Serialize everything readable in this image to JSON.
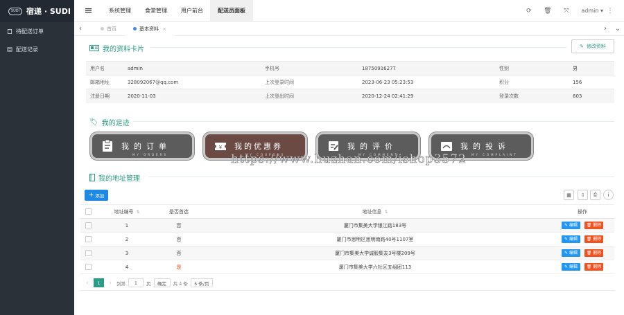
{
  "brand": {
    "badge": "SUDI",
    "name": "宿递 · SUDI"
  },
  "sidebar": {
    "items": [
      {
        "label": "待配送订单",
        "icon": "clipboard-icon"
      },
      {
        "label": "配送记录",
        "icon": "list-icon"
      }
    ]
  },
  "topnav": {
    "items": [
      {
        "label": "系统管理"
      },
      {
        "label": "食堂管理"
      },
      {
        "label": "用户前台"
      },
      {
        "label": "配送员面板"
      }
    ],
    "active": "配送员面板",
    "user": "admin"
  },
  "tabs": {
    "items": [
      {
        "label": "首页",
        "dot": "#cccccc"
      },
      {
        "label": "基本资料",
        "dot": "#3b8beb"
      }
    ]
  },
  "profile": {
    "title": "我的资料卡片",
    "edit_label": "修改资料",
    "rows": [
      [
        {
          "k": "用户名",
          "v": "admin"
        },
        {
          "k": "手机号",
          "v": "18750916277"
        },
        {
          "k": "性别",
          "v": "男"
        }
      ],
      [
        {
          "k": "邮箱地址",
          "v": "328092067@qq.com"
        },
        {
          "k": "上次登录时间",
          "v": "2023-06-23 05:23:53"
        },
        {
          "k": "积分",
          "v": "156"
        }
      ],
      [
        {
          "k": "注册日期",
          "v": "2020-11-03"
        },
        {
          "k": "上次登出时间",
          "v": "2020-12-24 02:41:29"
        },
        {
          "k": "登录次数",
          "v": "603"
        }
      ]
    ]
  },
  "footprint": {
    "title": "我的足迹",
    "buttons": [
      {
        "label": "我的订单",
        "sub": "MY ORDERS",
        "icon": "order-icon"
      },
      {
        "label": "我的优惠券",
        "sub": "MY COUPONS",
        "icon": "coupon-icon"
      },
      {
        "label": "我的评价",
        "sub": "MY COMMENT",
        "icon": "comment-icon"
      },
      {
        "label": "我的投诉",
        "sub": "MY COMPLAINT",
        "icon": "complaint-icon"
      }
    ],
    "watermark": "https://www.huzhan.com/ishop3572"
  },
  "address": {
    "title": "我的地址管理",
    "add_label": "添加",
    "headers": {
      "id": "地址编号",
      "default": "是否首选",
      "info": "地址信息",
      "ops": "操作"
    },
    "edit_label": "编辑",
    "delete_label": "删除",
    "rows": [
      {
        "id": "1",
        "default": "否",
        "info": "厦门市集美大学银江路183号"
      },
      {
        "id": "2",
        "default": "否",
        "info": "厦门市思明区思明南路40号1107室"
      },
      {
        "id": "3",
        "default": "否",
        "info": "厦门市集美大学诚毅集友3号楼209号"
      },
      {
        "id": "4",
        "default": "是",
        "info": "厦门市集美大学六社区五组团113"
      }
    ],
    "pager": {
      "page": "1",
      "goto_prefix": "到第",
      "goto_value": "1",
      "goto_suffix": "页",
      "confirm": "确定",
      "total": "共 4 条",
      "per_page": "5 条/页"
    }
  },
  "colors": {
    "accent": "#2a9b84",
    "primary": "#1e88e5",
    "danger": "#f4511e",
    "yes": "#e64a19"
  }
}
